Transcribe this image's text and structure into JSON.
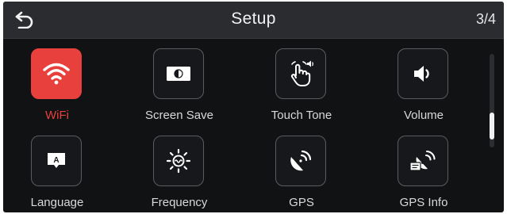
{
  "header": {
    "title": "Setup",
    "page_indicator": "3/4",
    "back_icon": "back-arrow-icon"
  },
  "grid": {
    "items": [
      {
        "label": "WiFi",
        "icon": "wifi-icon",
        "selected": true
      },
      {
        "label": "Screen Save",
        "icon": "screen-save-icon",
        "selected": false
      },
      {
        "label": "Touch Tone",
        "icon": "touch-tone-icon",
        "selected": false
      },
      {
        "label": "Volume",
        "icon": "volume-icon",
        "selected": false
      },
      {
        "label": "Language",
        "icon": "language-icon",
        "selected": false
      },
      {
        "label": "Frequency",
        "icon": "frequency-icon",
        "selected": false
      },
      {
        "label": "GPS",
        "icon": "gps-icon",
        "selected": false
      },
      {
        "label": "GPS Info",
        "icon": "gps-info-icon",
        "selected": false
      }
    ]
  },
  "colors": {
    "accent": "#e8403c",
    "background": "#111214",
    "header": "#2b2c2f",
    "text": "#d9d9d9"
  }
}
